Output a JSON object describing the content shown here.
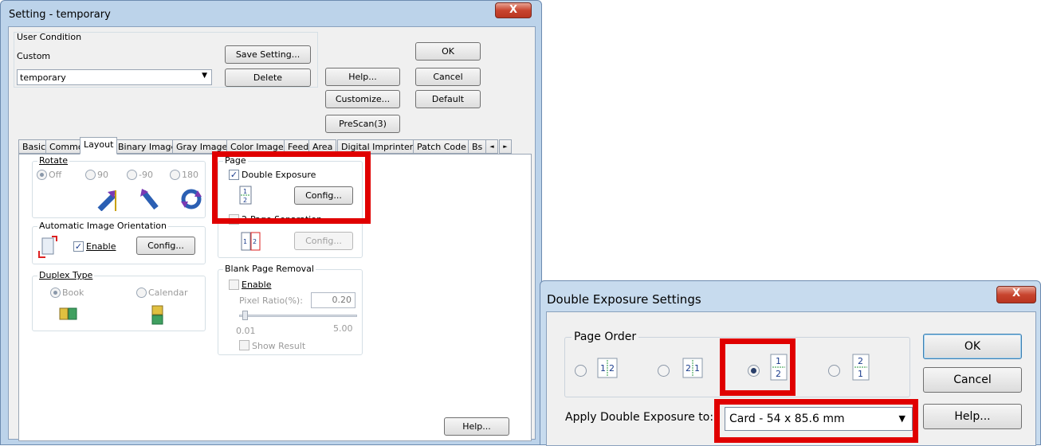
{
  "main_window": {
    "title": "Setting - temporary",
    "close_glyph": "X",
    "user_condition": {
      "label": "User Condition",
      "custom_label": "Custom",
      "selected": "temporary",
      "save_button": "Save Setting...",
      "delete_button": "Delete"
    },
    "buttons": {
      "ok": "OK",
      "cancel": "Cancel",
      "help": "Help...",
      "customize": "Customize...",
      "default": "Default",
      "prescan": "PreScan(3)",
      "bottom_help": "Help..."
    },
    "tabs": [
      "Basic",
      "Common",
      "Layout",
      "Binary Image",
      "Gray Image",
      "Color Image",
      "Feed",
      "Area",
      "Digital Imprinter",
      "Patch Code",
      "Bs"
    ],
    "active_tab": "Layout",
    "tab_scroll": {
      "left": "◄",
      "right": "►"
    },
    "rotate": {
      "label": "Rotate",
      "options": [
        "Off",
        "90",
        "-90",
        "180"
      ],
      "selected": "Off"
    },
    "auto_orientation": {
      "label": "Automatic Image Orientation",
      "enable_label": "Enable",
      "enabled": true,
      "config": "Config..."
    },
    "duplex": {
      "label": "Duplex Type",
      "options": [
        "Book",
        "Calendar"
      ],
      "selected": "Book"
    },
    "page": {
      "label": "Page",
      "double_exposure_label": "Double Exposure",
      "double_exposure_checked": true,
      "config": "Config...",
      "two_page_label": "2-Page Separation",
      "two_page_config": "Config..."
    },
    "blank_page": {
      "label": "Blank Page Removal",
      "enable_label": "Enable",
      "pixel_ratio_label": "Pixel Ratio(%):",
      "pixel_ratio_value": "0.20",
      "min": "0.01",
      "max": "5.00",
      "show_result": "Show Result"
    }
  },
  "double_exposure_dialog": {
    "title": "Double Exposure Settings",
    "close_glyph": "X",
    "page_order_label": "Page Order",
    "options": [
      "1|2",
      "2|1",
      "1/2",
      "2/1"
    ],
    "selected_index": 2,
    "apply_label": "Apply Double Exposure to:",
    "apply_value": "Card - 54 x 85.6 mm",
    "ok": "OK",
    "cancel": "Cancel",
    "help": "Help..."
  },
  "colors": {
    "highlight_red": "#e00000",
    "title_bar": "#bcd3ea",
    "close_red": "#c8452f",
    "accent_blue": "#2b5fb3"
  }
}
